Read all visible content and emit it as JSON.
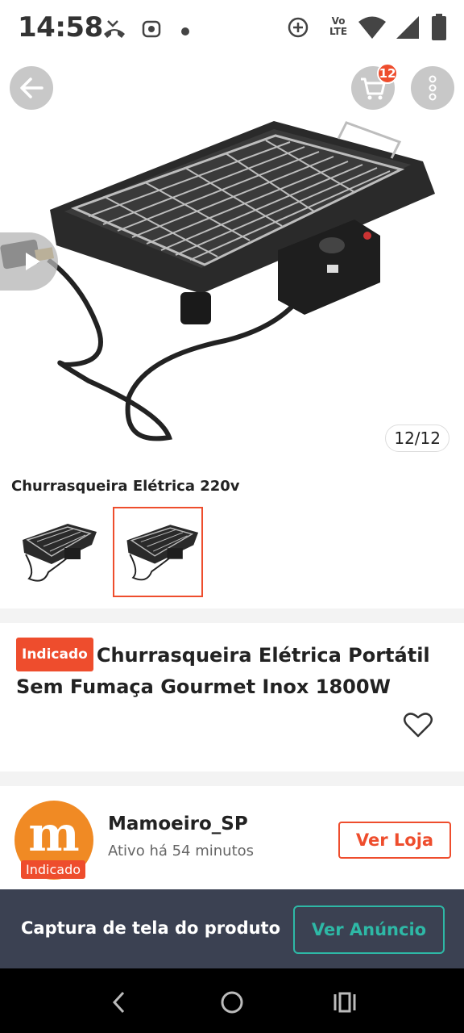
{
  "status_bar": {
    "time": "14:58",
    "icons": [
      "missed-call-icon",
      "media-icon",
      "dot-icon",
      "data-saver-icon",
      "volte-icon",
      "wifi-icon",
      "signal-icon",
      "battery-icon"
    ],
    "volte_label": "Vo LTE"
  },
  "header": {
    "back_icon": "arrow-left-icon",
    "cart_icon": "cart-icon",
    "cart_count": "12",
    "more_icon": "more-vertical-icon"
  },
  "gallery": {
    "counter": "12/12",
    "side_icon": "play-icon"
  },
  "variant": {
    "title": "Churrasqueira Elétrica 220v",
    "thumbnails": [
      {
        "name": "thumb-1",
        "selected": false
      },
      {
        "name": "thumb-2",
        "selected": true
      }
    ]
  },
  "product": {
    "badge": "Indicado",
    "title": "Churrasqueira Elétrica Portátil Sem Fumaça Gourmet Inox 1800W",
    "favorite_icon": "heart-icon"
  },
  "shop": {
    "avatar_letter": "m",
    "badge": "Indicado",
    "name": "Mamoeiro_SP",
    "status": "Ativo há 54 minutos",
    "button": "Ver Loja"
  },
  "banner": {
    "text": "Captura de tela do produto",
    "button": "Ver Anúncio"
  },
  "nav": {
    "back": "nav-back-icon",
    "home": "nav-home-icon",
    "recents": "nav-recents-icon"
  },
  "colors": {
    "accent": "#ee4d2d",
    "banner_bg": "#3b4152",
    "banner_button": "#2eb8a6",
    "avatar": "#f08a24"
  }
}
